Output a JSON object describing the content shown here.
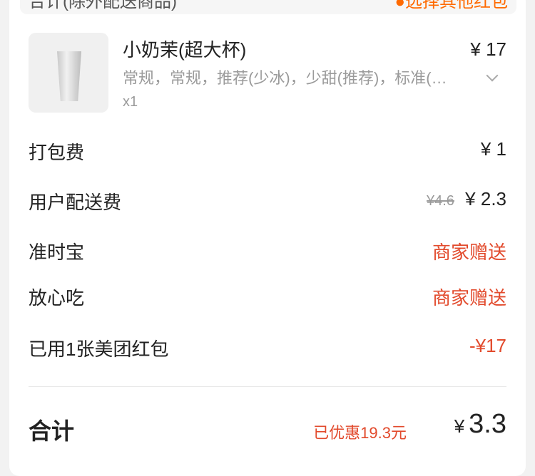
{
  "top": {
    "left_text": "合计(除外配送商品)",
    "right_text": "●选择其他红包"
  },
  "product": {
    "name": "小奶茉(超大杯)",
    "spec": "常规，常规，推荐(少冰)，少甜(推荐)，标准(…",
    "qty": "x1",
    "price": "¥ 17"
  },
  "fees": {
    "packing": {
      "label": "打包费",
      "value": "¥ 1"
    },
    "delivery": {
      "label": "用户配送费",
      "original": "¥4.6",
      "value": "¥ 2.3"
    },
    "ontime": {
      "label": "准时宝",
      "value": "商家赠送"
    },
    "safe": {
      "label": "放心吃",
      "value": "商家赠送"
    },
    "coupon": {
      "label": "已用1张美团红包",
      "value": "-¥17"
    }
  },
  "total": {
    "label": "合计",
    "discount": "已优惠19.3元",
    "currency": "¥",
    "amount": "3.3"
  }
}
